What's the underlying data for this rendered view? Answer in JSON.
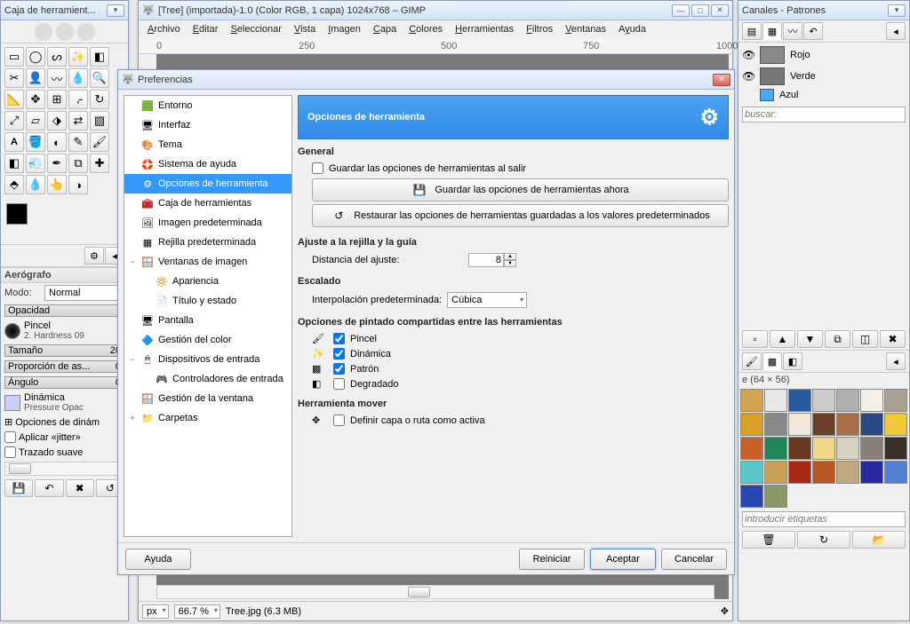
{
  "toolbox": {
    "title": "Caja de herramient...",
    "tool_opts_title": "Aerógrafo",
    "mode_label": "Modo:",
    "mode_value": "Normal",
    "opacity_label": "Opacidad",
    "brush_label": "Pincel",
    "brush_name": "2. Hardness 09",
    "size_label": "Tamaño",
    "size_value": "20",
    "aspect_label": "Proporción de as...",
    "aspect_value": "0",
    "angle_label": "Ángulo",
    "angle_value": "0",
    "dynamics_label": "Dinámica",
    "dynamics_name": "Pressure Opac",
    "dyn_opts": "Opciones de dinám",
    "jitter": "Aplicar «jitter»",
    "smooth": "Trazado suave"
  },
  "mainwin": {
    "title": "[Tree] (importada)-1.0 (Color RGB, 1 capa) 1024x768 – GIMP",
    "menu": [
      "Archivo",
      "Editar",
      "Seleccionar",
      "Vista",
      "Imagen",
      "Capa",
      "Colores",
      "Herramientas",
      "Filtros",
      "Ventanas",
      "Ayuda"
    ],
    "ruler_marks": [
      "0",
      "250",
      "500",
      "750",
      "1000"
    ],
    "status_unit": "px",
    "status_zoom": "66.7 %",
    "status_file": "Tree.jpg (6.3 MB)"
  },
  "rightpanel": {
    "title": "Canales - Patrones",
    "channels": [
      "Rojo",
      "Verde",
      "Azul"
    ],
    "search_placeholder": "buscar:",
    "pattern_label": "e (64 × 56)",
    "tags_placeholder": "introducir etiquetas"
  },
  "pref": {
    "title": "Preferencias",
    "tree": [
      {
        "label": "Entorno",
        "icon": "🟩"
      },
      {
        "label": "Interfaz",
        "icon": "🖥"
      },
      {
        "label": "Tema",
        "icon": "🎨"
      },
      {
        "label": "Sistema de ayuda",
        "icon": "🛟"
      },
      {
        "label": "Opciones de herramienta",
        "icon": "⚙",
        "selected": true
      },
      {
        "label": "Caja de herramientas",
        "icon": "🧰"
      },
      {
        "label": "Imagen predeterminada",
        "icon": "🖼"
      },
      {
        "label": "Rejilla predeterminada",
        "icon": "▦"
      },
      {
        "label": "Ventanas de imagen",
        "icon": "🪟",
        "expandable": "−"
      },
      {
        "label": "Apariencia",
        "icon": "🔆",
        "child": true
      },
      {
        "label": "Título y estado",
        "icon": "📄",
        "child": true
      },
      {
        "label": "Pantalla",
        "icon": "🖥"
      },
      {
        "label": "Gestión del color",
        "icon": "🔷"
      },
      {
        "label": "Dispositivos de entrada",
        "icon": "🖱",
        "expandable": "−"
      },
      {
        "label": "Controladores de entrada",
        "icon": "🎮",
        "child": true
      },
      {
        "label": "Gestión de la ventana",
        "icon": "🪟"
      },
      {
        "label": "Carpetas",
        "icon": "📁",
        "expandable": "+"
      }
    ],
    "header": "Opciones de herramienta",
    "sec_general": "General",
    "save_on_exit": "Guardar las opciones de herramientas al salir",
    "save_now_btn": "Guardar las opciones de herramientas ahora",
    "reset_btn": "Restaurar las opciones de herramientas guardadas a los valores predeterminados",
    "sec_snap": "Ajuste a la rejilla y la guía",
    "snap_dist_label": "Distancia del ajuste:",
    "snap_dist_value": "8",
    "sec_scale": "Escalado",
    "interp_label": "Interpolación predeterminada:",
    "interp_value": "Cúbica",
    "sec_paint": "Opciones de pintado compartidas entre las herramientas",
    "paint_opts": [
      "Pincel",
      "Dinámica",
      "Patrón",
      "Degradado"
    ],
    "sec_move": "Herramienta mover",
    "move_opt": "Definir capa o ruta como activa",
    "help_btn": "Ayuda",
    "reset_dlg_btn": "Reiniciar",
    "ok_btn": "Aceptar",
    "cancel_btn": "Cancelar"
  }
}
